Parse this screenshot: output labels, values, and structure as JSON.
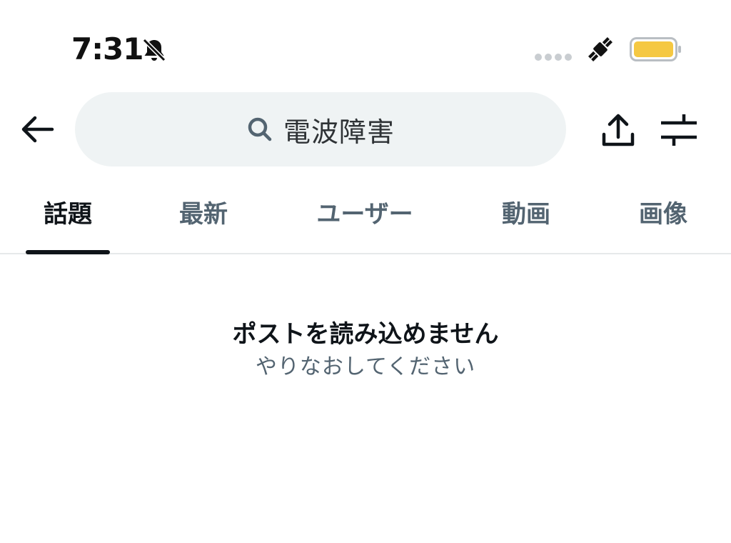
{
  "status_bar": {
    "time": "7:31",
    "icons": [
      "bell-slash-icon",
      "signal-dots-icon",
      "satellite-icon",
      "battery-icon"
    ],
    "battery_color": "#f5c842"
  },
  "header": {
    "back_icon": "arrow-left-icon",
    "search_query": "電波障害",
    "search_icon": "search-icon",
    "share_icon": "share-upload-icon",
    "filter_icon": "sliders-icon"
  },
  "tabs": [
    {
      "label": "話題",
      "active": true
    },
    {
      "label": "最新",
      "active": false
    },
    {
      "label": "ユーザー",
      "active": false
    },
    {
      "label": "動画",
      "active": false
    },
    {
      "label": "画像",
      "active": false
    }
  ],
  "empty_state": {
    "title": "ポストを読み込めません",
    "subtitle": "やりなおしてください"
  },
  "colors": {
    "text_primary": "#0f1419",
    "text_secondary": "#536471",
    "search_bg": "#eff3f4",
    "divider": "#e6e9ea"
  }
}
